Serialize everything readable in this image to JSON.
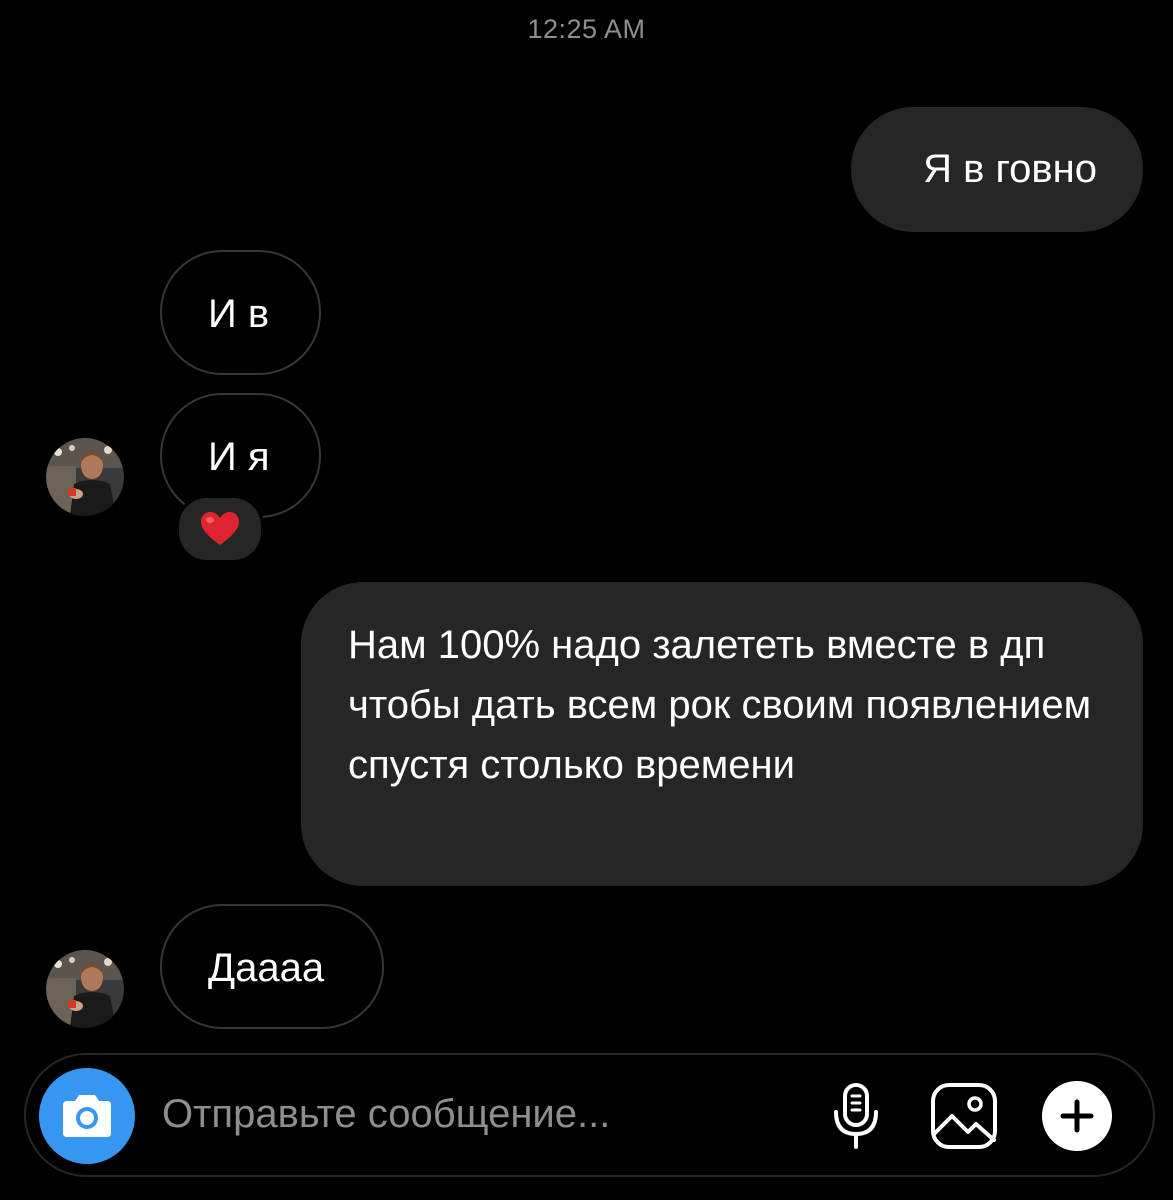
{
  "thread": {
    "timestamp": "12:25 AM",
    "messages": [
      {
        "sender": "me",
        "text": "Я в говно"
      },
      {
        "sender": "them",
        "text": "И в"
      },
      {
        "sender": "them",
        "text": "И я",
        "reaction": "heart-icon"
      },
      {
        "sender": "me",
        "text": "Нам 100% надо залететь вместе в дп чтобы дать всем рок своим появлением спустя столько времени"
      },
      {
        "sender": "them",
        "text": "Даааа"
      }
    ]
  },
  "composer": {
    "placeholder": "Отправьте сообщение...",
    "value": "",
    "buttons": [
      "camera-icon",
      "microphone-icon",
      "gallery-icon",
      "plus-icon"
    ]
  },
  "colors": {
    "background": "#000000",
    "sent_bubble": "#262626",
    "received_border": "#363636",
    "accent": "#3797f0",
    "muted_text": "#8e8e8e",
    "reaction_heart": "#e0242f"
  }
}
